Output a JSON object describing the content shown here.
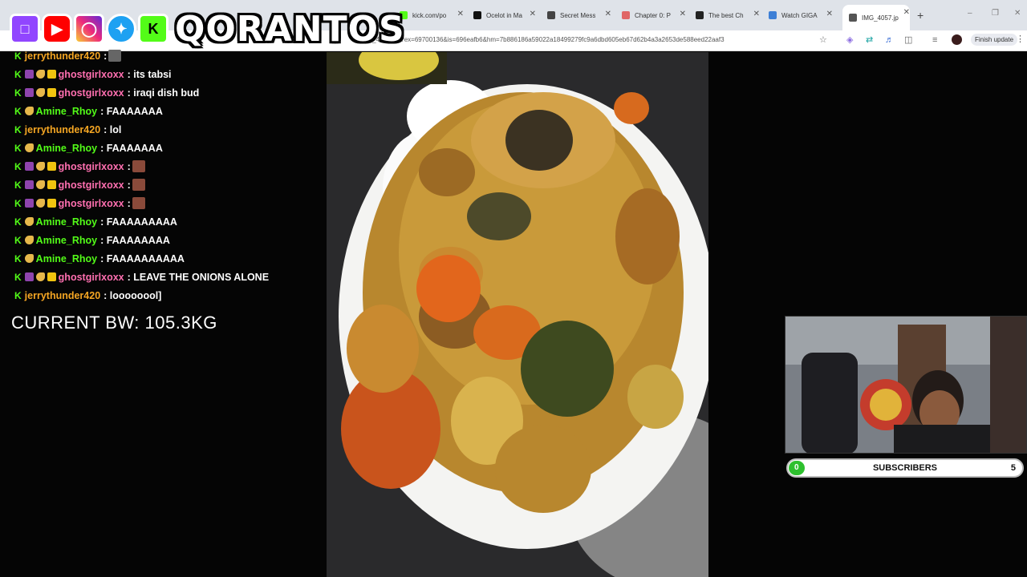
{
  "browser": {
    "tabs": [
      {
        "label": "kick.com/po",
        "color": "#53fc18"
      },
      {
        "label": "Ocelot in Ma",
        "color": "#111111"
      },
      {
        "label": "Secret Mess",
        "color": "#444444"
      },
      {
        "label": "Chapter 0: P",
        "color": "#e06666"
      },
      {
        "label": "The best Ch",
        "color": "#222222"
      },
      {
        "label": "Watch GIGA",
        "color": "#3d7fd6"
      },
      {
        "label": "IMG_4057.jp",
        "color": "#555555"
      }
    ],
    "url": "IMG_4057.jpg?ex=69700136&is=696eafb6&hm=7b886186a59022a18499279fc9a6dbd605eb67d62b4a3a2653de588eed22aaf3",
    "finish_update": "Finish update"
  },
  "overlay": {
    "brand": "QORANTOS"
  },
  "chat": {
    "messages": [
      {
        "user": "jerrythunder420",
        "user_color": "#f5a623",
        "badges": [
          "kick"
        ],
        "text": " : ",
        "emotes": 1
      },
      {
        "user": "ghostgirlxoxx",
        "user_color": "#ff6fb0",
        "badges": [
          "kick",
          "gem",
          "moon",
          "crown"
        ],
        "text": " : its tabsi",
        "emotes": 0
      },
      {
        "user": "ghostgirlxoxx",
        "user_color": "#ff6fb0",
        "badges": [
          "kick",
          "gem",
          "moon",
          "crown"
        ],
        "text": " : iraqi dish bud",
        "emotes": 0
      },
      {
        "user": "Amine_Rhoy",
        "user_color": "#53fc18",
        "badges": [
          "kick",
          "moon"
        ],
        "text": " : FAAAAAAA",
        "emotes": 0
      },
      {
        "user": "jerrythunder420",
        "user_color": "#f5a623",
        "badges": [
          "kick"
        ],
        "text": " : lol",
        "emotes": 0
      },
      {
        "user": "Amine_Rhoy",
        "user_color": "#53fc18",
        "badges": [
          "kick",
          "moon"
        ],
        "text": " : FAAAAAAA",
        "emotes": 0
      },
      {
        "user": "ghostgirlxoxx",
        "user_color": "#ff6fb0",
        "badges": [
          "kick",
          "gem",
          "moon",
          "crown"
        ],
        "text": " : ",
        "emotes": 1
      },
      {
        "user": "ghostgirlxoxx",
        "user_color": "#ff6fb0",
        "badges": [
          "kick",
          "gem",
          "moon",
          "crown"
        ],
        "text": " : ",
        "emotes": 1
      },
      {
        "user": "ghostgirlxoxx",
        "user_color": "#ff6fb0",
        "badges": [
          "kick",
          "gem",
          "moon",
          "crown"
        ],
        "text": " : ",
        "emotes": 1
      },
      {
        "user": "Amine_Rhoy",
        "user_color": "#53fc18",
        "badges": [
          "kick",
          "moon"
        ],
        "text": " : FAAAAAAAAA",
        "emotes": 0
      },
      {
        "user": "Amine_Rhoy",
        "user_color": "#53fc18",
        "badges": [
          "kick",
          "moon"
        ],
        "text": " : FAAAAAAAA",
        "emotes": 0
      },
      {
        "user": "Amine_Rhoy",
        "user_color": "#53fc18",
        "badges": [
          "kick",
          "moon"
        ],
        "text": " : FAAAAAAAAAA",
        "emotes": 0
      },
      {
        "user": "ghostgirlxoxx",
        "user_color": "#ff6fb0",
        "badges": [
          "kick",
          "gem",
          "moon",
          "crown"
        ],
        "text": " : LEAVE THE ONIONS ALONE",
        "emotes": 0
      },
      {
        "user": "jerrythunder420",
        "user_color": "#f5a623",
        "badges": [
          "kick"
        ],
        "text": " : loooooool]",
        "emotes": 0
      }
    ]
  },
  "stats": {
    "bodyweight": "CURRENT BW: 105.3KG"
  },
  "subgoal": {
    "current": "0",
    "label": "SUBSCRIBERS",
    "target": "5",
    "progress_fraction": 0.0
  }
}
